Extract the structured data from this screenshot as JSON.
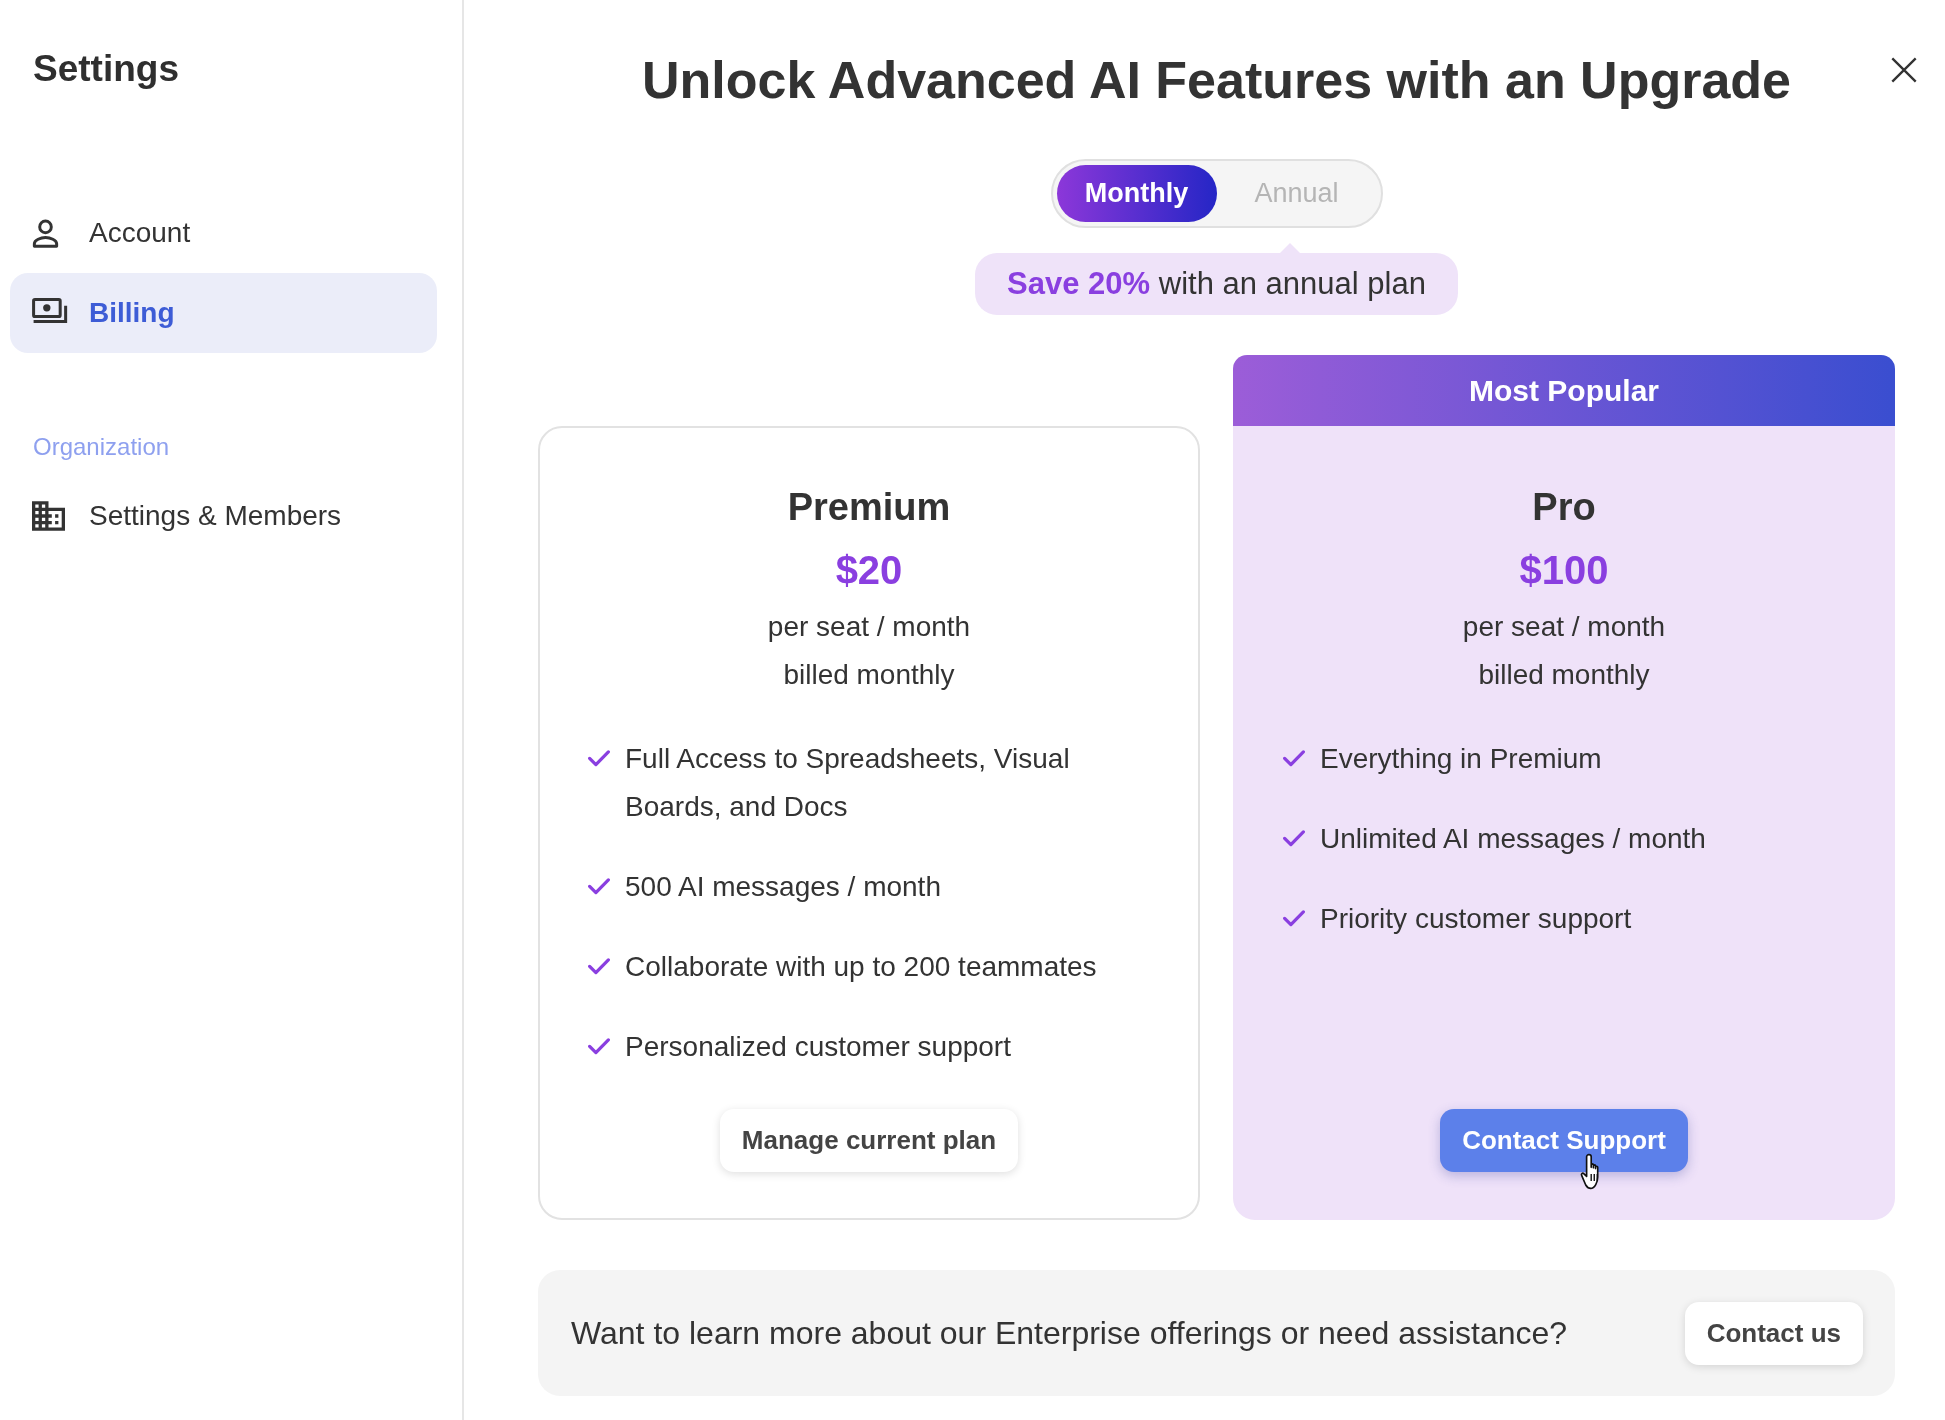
{
  "sidebar": {
    "title": "Settings",
    "items": [
      {
        "label": "Account",
        "selected": false
      },
      {
        "label": "Billing",
        "selected": true
      }
    ],
    "section": {
      "heading": "Organization",
      "items": [
        {
          "label": "Settings & Members",
          "selected": false
        }
      ]
    }
  },
  "modal": {
    "title": "Unlock Advanced AI Features with an Upgrade",
    "billing_period": [
      {
        "label": "Monthly",
        "selected": true
      },
      {
        "label": "Annual",
        "selected": false
      }
    ],
    "savings_note": "**Save 20%** with an annual plan",
    "plans": [
      {
        "name": "Premium",
        "price": "$20",
        "unit": "per seat / month",
        "billing": "billed monthly",
        "features": [
          "Full Access to Spreadsheets, Visual Boards, and Docs",
          "500 AI messages / month",
          "Collaborate with up to 200 teammates",
          "Personalized customer support"
        ],
        "button": "Manage current plan",
        "featured": false,
        "button_hovered": false
      },
      {
        "badge": "Most Popular",
        "name": "Pro",
        "price": "$100",
        "unit": "per seat / month",
        "billing": "billed monthly",
        "features": [
          "Everything in Premium",
          "Unlimited AI messages / month",
          "Priority customer support"
        ],
        "button": "Contact Support",
        "featured": true,
        "button_hovered": true
      }
    ],
    "enterprise": {
      "text": "Want to learn more about our Enterprise offerings or need assistance?",
      "button": "Contact us"
    }
  }
}
